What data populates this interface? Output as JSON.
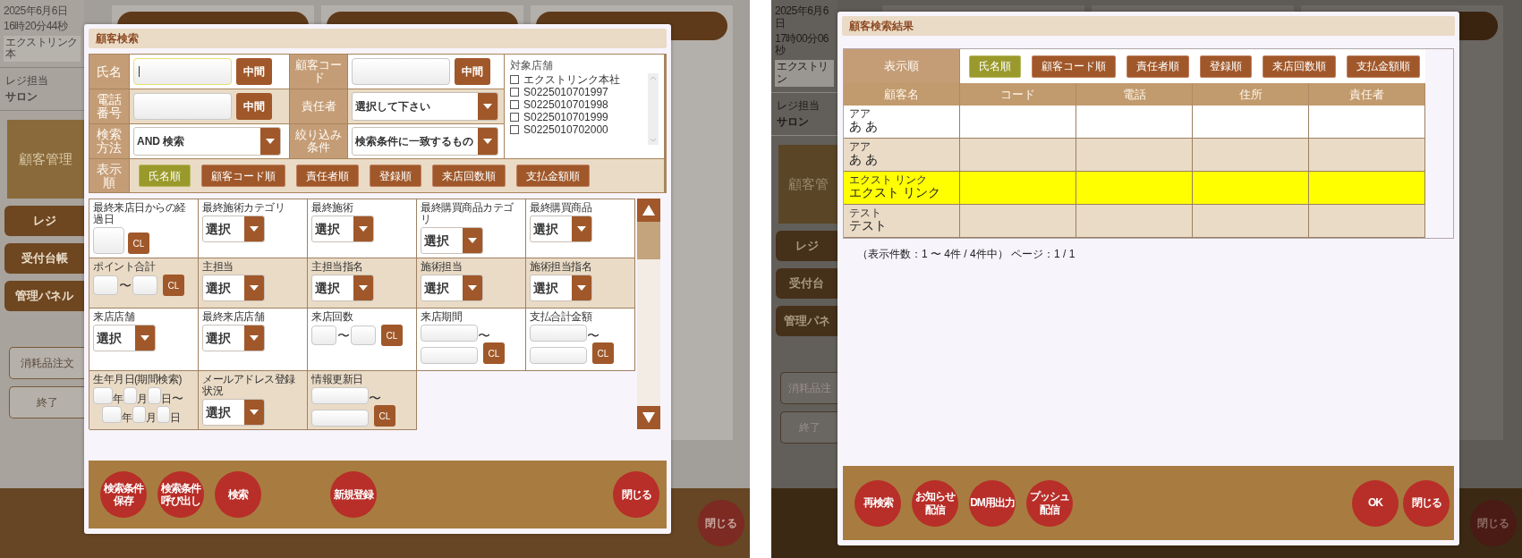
{
  "screens": [
    {
      "background": {
        "date": "2025年6月6日",
        "time": "16時20分44秒",
        "store": "エクストリンク本",
        "staff_label": "レジ担当",
        "staff_name": "サロン",
        "menu_tile": "顧客管理",
        "menu": [
          "レジ",
          "受付台帳",
          "管理パネル"
        ],
        "buttons": [
          "消耗品注文",
          "終了"
        ],
        "close": "閉じる"
      },
      "dialog": {
        "kind": "search_form",
        "title": "顧客検索",
        "fields": [
          {
            "label": "氏名",
            "kind": "text",
            "focused": true,
            "button": "中間"
          },
          {
            "label": "顧客コード",
            "kind": "text",
            "focused": false,
            "button": "中間"
          },
          {
            "label": "電話番号",
            "kind": "text",
            "focused": false,
            "button": "中間"
          },
          {
            "label": "責任者",
            "kind": "select",
            "focused": false,
            "value": "選択して下さい"
          },
          {
            "label": "検索方法",
            "kind": "select",
            "focused": false,
            "value": "AND 検索"
          },
          {
            "label": "絞り込み条件",
            "kind": "select",
            "focused": false,
            "value": "検索条件に一致するもの"
          }
        ],
        "stores": {
          "label": "対象店舗",
          "items": [
            {
              "label": "エクストリンク本社",
              "checked": false
            },
            {
              "label": "S0225010701997",
              "checked": false
            },
            {
              "label": "S0225010701998",
              "checked": false
            },
            {
              "label": "S0225010701999",
              "checked": false
            },
            {
              "label": "S0225010702000",
              "checked": false
            }
          ]
        },
        "sort": {
          "label": "表示順",
          "options": [
            {
              "label": "氏名順",
              "selected": true
            },
            {
              "label": "顧客コード順",
              "selected": false
            },
            {
              "label": "責任者順",
              "selected": false
            },
            {
              "label": "登録順",
              "selected": false
            },
            {
              "label": "来店回数順",
              "selected": false
            },
            {
              "label": "支払金額順",
              "selected": false
            }
          ]
        },
        "criteria": [
          {
            "label": "最終来店日からの経過日",
            "kind": "input",
            "button": "CL"
          },
          {
            "label": "最終施術カテゴリ",
            "kind": "select",
            "value": "選択"
          },
          {
            "label": "最終施術",
            "kind": "select",
            "value": "選択"
          },
          {
            "label": "最終購買商品カテゴリ",
            "kind": "select",
            "value": "選択"
          },
          {
            "label": "最終購買商品",
            "kind": "select",
            "value": "選択"
          },
          {
            "label": "ポイント合計",
            "kind": "range",
            "separator": "〜",
            "button": "CL"
          },
          {
            "label": "主担当",
            "kind": "select",
            "value": "選択"
          },
          {
            "label": "主担当指名",
            "kind": "select",
            "value": "選択"
          },
          {
            "label": "施術担当",
            "kind": "select",
            "value": "選択"
          },
          {
            "label": "施術担当指名",
            "kind": "select",
            "value": "選択"
          },
          {
            "label": "来店店舗",
            "kind": "select",
            "value": "選択"
          },
          {
            "label": "最終来店店舗",
            "kind": "select",
            "value": "選択"
          },
          {
            "label": "来店回数",
            "kind": "range",
            "separator": "〜",
            "button": "CL"
          },
          {
            "label": "来店期間",
            "kind": "range_stacked",
            "separator": "〜",
            "button": "CL"
          },
          {
            "label": "支払合計金額",
            "kind": "range_stacked",
            "separator": "〜",
            "button": "CL"
          },
          {
            "label": "生年月日(期間検索)",
            "kind": "date_range",
            "from_units": [
              "年",
              "月",
              "日"
            ],
            "separator": "〜",
            "to_units": [
              "年",
              "月",
              "日"
            ]
          },
          {
            "label": "メールアドレス登録状況",
            "kind": "select",
            "value": "選択"
          },
          {
            "label": "情報更新日",
            "kind": "range_stacked",
            "separator": "〜",
            "button": "CL"
          }
        ],
        "footer": {
          "start": [
            "検索条件保存",
            "検索条件呼び出し",
            "検索"
          ],
          "middle": [
            "新規登録"
          ],
          "end": [
            "閉じる"
          ]
        }
      }
    },
    {
      "background": {
        "date": "2025年6月6日",
        "time": "17時00分06秒",
        "store": "エクストリン",
        "staff_label": "レジ担当",
        "staff_name": "サロン",
        "menu_tile": "顧客管",
        "menu": [
          "レジ",
          "受付台",
          "管理パネ"
        ],
        "buttons": [
          "消耗品注",
          "終了"
        ],
        "close": "閉じる"
      },
      "dialog": {
        "kind": "search_results",
        "title": "顧客検索結果",
        "sort": {
          "label": "表示順",
          "options": [
            {
              "label": "氏名順",
              "selected": true
            },
            {
              "label": "顧客コード順",
              "selected": false
            },
            {
              "label": "責任者順",
              "selected": false
            },
            {
              "label": "登録順",
              "selected": false
            },
            {
              "label": "来店回数順",
              "selected": false
            },
            {
              "label": "支払金額順",
              "selected": false
            }
          ]
        },
        "columns": [
          "顧客名",
          "コード",
          "電話",
          "住所",
          "責任者"
        ],
        "rows": [
          {
            "kana": "アア",
            "name": "あ あ",
            "selected": false
          },
          {
            "kana": "アア",
            "name": "あ あ",
            "selected": false
          },
          {
            "kana": "エクスト リンク",
            "name": "エクスト リンク",
            "selected": true
          },
          {
            "kana": "テスト",
            "name": "テスト",
            "selected": false
          }
        ],
        "summary": "（表示件数：1 〜 4件 / 4件中） ページ：1 / 1",
        "footer": {
          "start": [
            "再検索",
            "お知らせ配信",
            "DM用出力",
            "プッシュ配信"
          ],
          "end": [
            "OK",
            "閉じる"
          ]
        }
      }
    }
  ]
}
